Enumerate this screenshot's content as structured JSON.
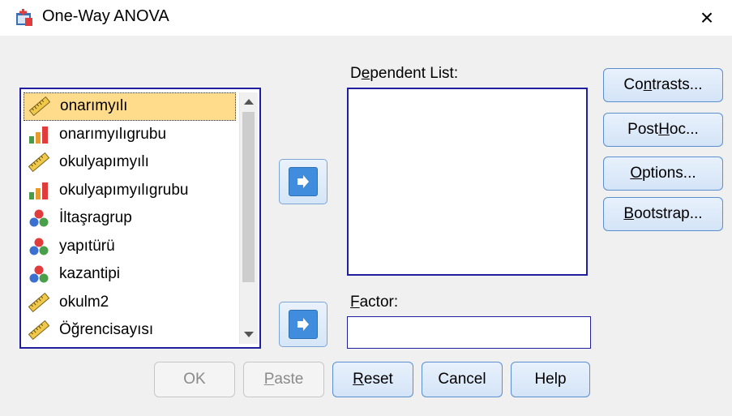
{
  "window": {
    "title": "One-Way ANOVA",
    "close_glyph": "×"
  },
  "variables": [
    {
      "label": "onarımyılı",
      "icon": "ruler-icon",
      "selected": true
    },
    {
      "label": "onarımyılıgrubu",
      "icon": "bar-chart-icon"
    },
    {
      "label": "okulyapımyılı",
      "icon": "ruler-icon"
    },
    {
      "label": "okulyapımyılıgrubu",
      "icon": "bar-chart-icon"
    },
    {
      "label": "İltaşragrup",
      "icon": "nominal-icon"
    },
    {
      "label": "yapıtürü",
      "icon": "nominal-icon"
    },
    {
      "label": "kazantipi",
      "icon": "nominal-icon"
    },
    {
      "label": "okulm2",
      "icon": "ruler-icon"
    },
    {
      "label": "Öğrencisayısı",
      "icon": "ruler-icon"
    }
  ],
  "dependent": {
    "label": "Dependent List:",
    "mnemonic_index": 1
  },
  "factor": {
    "label": "Factor:",
    "mnemonic_index": 0
  },
  "side_buttons": [
    {
      "id": "contrasts",
      "label": "Contrasts...",
      "mnemonic_index": 2
    },
    {
      "id": "post-hoc",
      "label": "Post Hoc...",
      "mnemonic_index": 5
    },
    {
      "id": "options",
      "label": "Options...",
      "mnemonic_index": 0
    },
    {
      "id": "bootstrap",
      "label": "Bootstrap...",
      "mnemonic_index": 0
    }
  ],
  "bottom_buttons": [
    {
      "id": "ok",
      "label": "OK",
      "disabled": true,
      "mnemonic_index": -1
    },
    {
      "id": "paste",
      "label": "Paste",
      "disabled": true,
      "mnemonic_index": 0
    },
    {
      "id": "reset",
      "label": "Reset",
      "disabled": false,
      "mnemonic_index": 0
    },
    {
      "id": "cancel",
      "label": "Cancel",
      "disabled": false,
      "mnemonic_index": -1
    },
    {
      "id": "help",
      "label": "Help",
      "disabled": false,
      "mnemonic_index": -1
    }
  ],
  "colors": {
    "accent_border": "#1f1f9f",
    "selection": "#ffdc8c",
    "arrow_blue": "#3f8ddc"
  }
}
